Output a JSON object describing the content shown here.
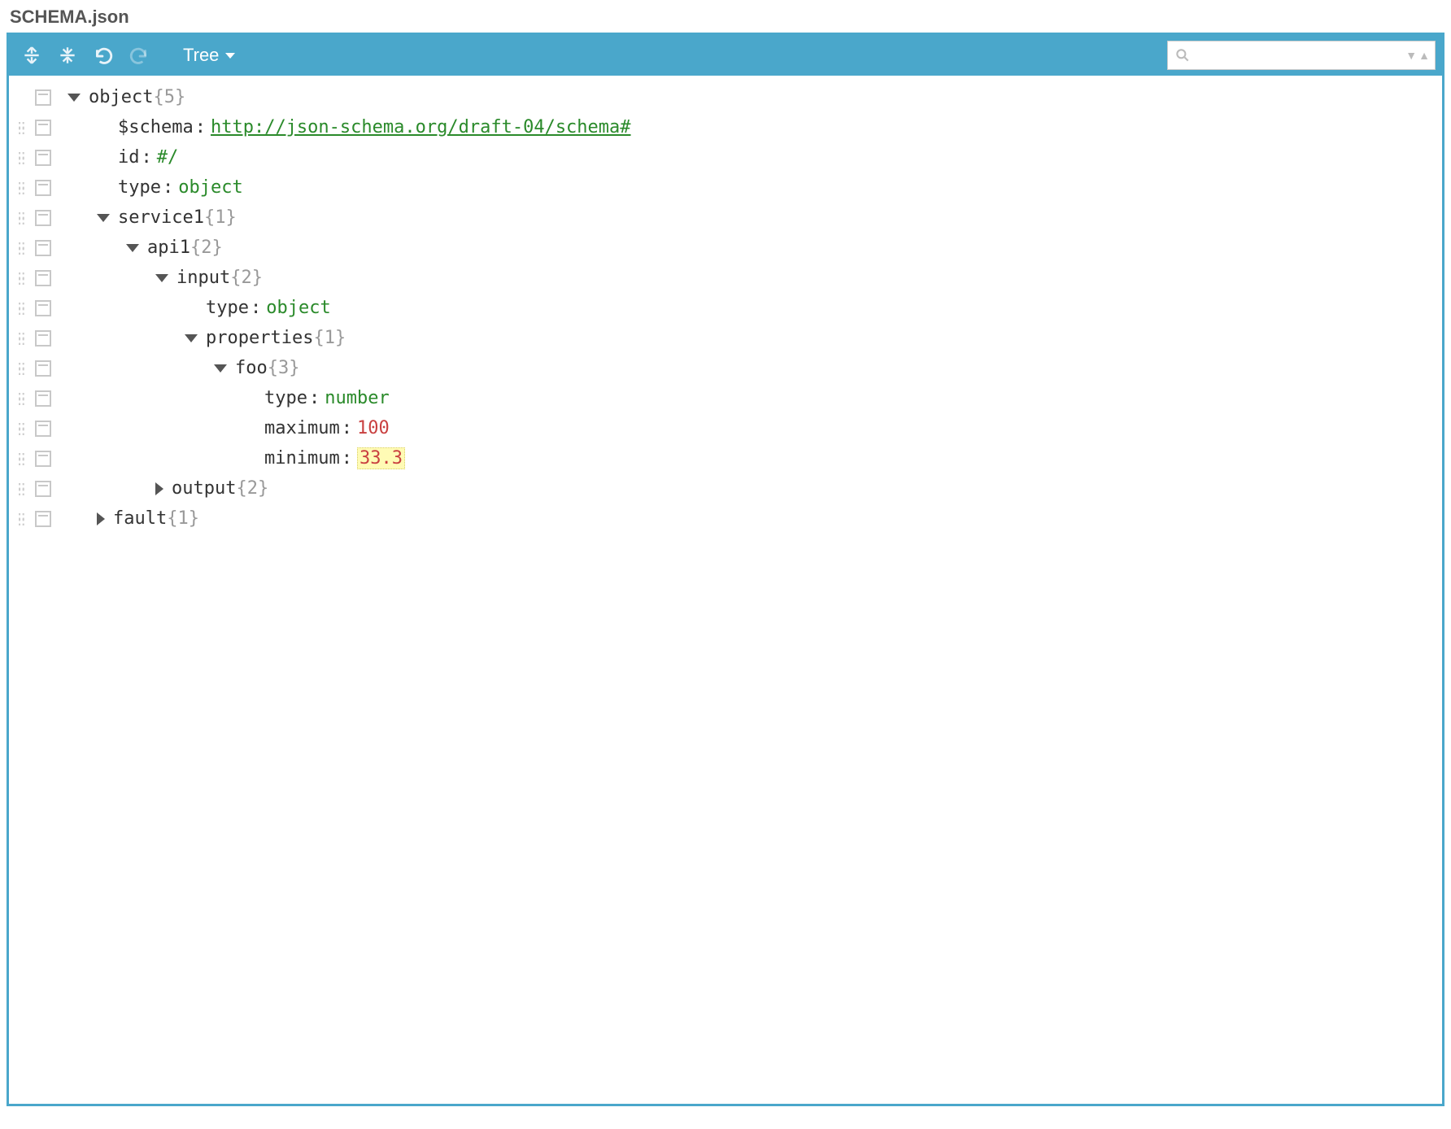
{
  "file_title": "SCHEMA.json",
  "toolbar": {
    "mode_label": "Tree",
    "search_placeholder": ""
  },
  "tree": [
    {
      "depth": 0,
      "grip": false,
      "expander": "open",
      "key": "object",
      "count": "{5}"
    },
    {
      "depth": 1,
      "grip": true,
      "expander": "none",
      "key": "$schema",
      "sep": ":",
      "value": "http://json-schema.org/draft-04/schema#",
      "vtype": "url"
    },
    {
      "depth": 1,
      "grip": true,
      "expander": "none",
      "key": "id",
      "sep": ":",
      "value": "#/",
      "vtype": "string",
      "key_pad": "  "
    },
    {
      "depth": 1,
      "grip": true,
      "expander": "none",
      "key": "type",
      "sep": ":",
      "value": "object",
      "vtype": "string"
    },
    {
      "depth": 1,
      "grip": true,
      "expander": "open",
      "key": "service1",
      "count": "{1}"
    },
    {
      "depth": 2,
      "grip": true,
      "expander": "open",
      "key": "api1",
      "count": "{2}"
    },
    {
      "depth": 3,
      "grip": true,
      "expander": "open",
      "key": "input",
      "count": "{2}"
    },
    {
      "depth": 4,
      "grip": true,
      "expander": "none",
      "key": "type",
      "sep": ":",
      "value": "object",
      "vtype": "string"
    },
    {
      "depth": 4,
      "grip": true,
      "expander": "open",
      "key": "properties",
      "count": "{1}"
    },
    {
      "depth": 5,
      "grip": true,
      "expander": "open",
      "key": "foo",
      "count": "{3}"
    },
    {
      "depth": 6,
      "grip": true,
      "expander": "none",
      "key": "type",
      "sep": ":",
      "value": "number",
      "vtype": "string"
    },
    {
      "depth": 6,
      "grip": true,
      "expander": "none",
      "key": "maximum",
      "sep": ":",
      "value": "100",
      "vtype": "number"
    },
    {
      "depth": 6,
      "grip": true,
      "expander": "none",
      "key": "minimum",
      "sep": ":",
      "value": "33.3",
      "vtype": "number",
      "highlight": true
    },
    {
      "depth": 3,
      "grip": true,
      "expander": "closed",
      "key": "output",
      "count": "{2}"
    },
    {
      "depth": 1,
      "grip": true,
      "expander": "closed",
      "key": "fault",
      "count": "{1}"
    }
  ]
}
